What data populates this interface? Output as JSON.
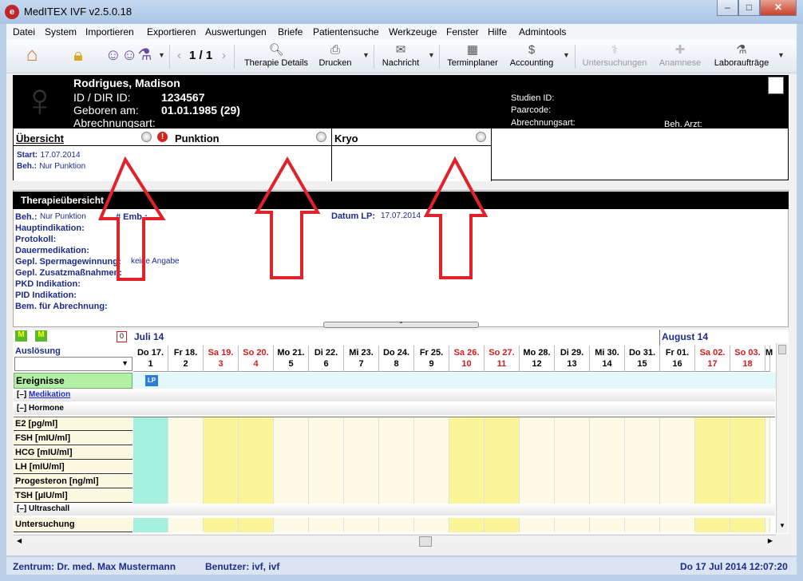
{
  "window": {
    "title": "MedITEX IVF v2.5.0.18",
    "app_icon": "e"
  },
  "menubar": [
    "Datei",
    "System",
    "Importieren",
    "Exportieren",
    "Auswertungen",
    "Briefe",
    "Patientensuche",
    "Werkzeuge",
    "Fenster",
    "Hilfe",
    "Admintools"
  ],
  "toolbar": {
    "page_indicator": "1 / 1",
    "therapie_details": "Therapie Details",
    "drucken": "Drucken",
    "nachricht": "Nachricht",
    "terminplaner": "Terminplaner",
    "accounting": "Accounting",
    "untersuchungen": "Untersuchungen",
    "anamnese": "Anamnese",
    "laborauftraege": "Laboraufträge"
  },
  "patient": {
    "name": "Rodrigues, Madison",
    "id_label": "ID / DIR ID:",
    "id_value": "1234567",
    "born_label": "Geboren am:",
    "born_value": "01.01.1985",
    "age": "(29)",
    "billing_label": "Abrechnungsart:",
    "studien_id_label": "Studien ID:",
    "paarcode_label": "Paarcode:",
    "abrechnungsart_label": "Abrechnungsart:",
    "beh_arzt_label": "Beh. Arzt:"
  },
  "tabs": [
    {
      "title": "Übersicht",
      "start_label": "Start:",
      "start_value": "17.07.2014",
      "beh_label": "Beh.:",
      "beh_value": "Nur Punktion"
    },
    {
      "title": "Punktion"
    },
    {
      "title": "Kryo"
    }
  ],
  "therapy": {
    "header": "Therapieübersicht",
    "beh_label": "Beh.:",
    "beh_value": "Nur Punktion",
    "emb_label": "# Emb.:",
    "datum_lp_label": "Datum LP:",
    "datum_lp_value": "17.07.2014",
    "fields": [
      "Hauptindikation:",
      "Protokoll:",
      "Dauermedikation:",
      "Gepl. Spermagewinnung:",
      "Gepl. Zusatzmaßnahmen:",
      "PKD Indikation:",
      "PID Indikation:",
      "Bem. für Abrechnung:"
    ],
    "sperm_value": "keine Angabe"
  },
  "calendar": {
    "month1": "Juli 14",
    "month2": "August 14",
    "ausloesung_label": "Auslösung",
    "calendar_icon_day": "0",
    "days": [
      {
        "d": "Do 17.",
        "n": "1"
      },
      {
        "d": "Fr 18.",
        "n": "2"
      },
      {
        "d": "Sa 19.",
        "n": "3"
      },
      {
        "d": "So 20.",
        "n": "4"
      },
      {
        "d": "Mo 21.",
        "n": "5"
      },
      {
        "d": "Di 22.",
        "n": "6"
      },
      {
        "d": "Mi 23.",
        "n": "7"
      },
      {
        "d": "Do 24.",
        "n": "8"
      },
      {
        "d": "Fr 25.",
        "n": "9"
      },
      {
        "d": "Sa 26.",
        "n": "10"
      },
      {
        "d": "So 27.",
        "n": "11"
      },
      {
        "d": "Mo 28.",
        "n": "12"
      },
      {
        "d": "Di 29.",
        "n": "13"
      },
      {
        "d": "Mi 30.",
        "n": "14"
      },
      {
        "d": "Do 31.",
        "n": "15"
      },
      {
        "d": "Fr 01.",
        "n": "16"
      },
      {
        "d": "Sa 02.",
        "n": "17"
      },
      {
        "d": "So 03.",
        "n": "18"
      },
      {
        "d": "M",
        "n": ""
      }
    ],
    "ereignisse_label": "Ereignisse",
    "lp_badge": "LP",
    "section_medikation": "Medikation",
    "section_hormone": "Hormone",
    "section_ultraschall": "Ultraschall",
    "hormone_rows": [
      "E2  [pg/ml]",
      "FSH  [mIU/ml]",
      "HCG  [mIU/ml]",
      "LH  [mIU/ml]",
      "Progesteron  [ng/ml]",
      "TSH  [µIU/ml]"
    ],
    "untersuchung_label": "Untersuchung",
    "collapse_symbol": "[–]"
  },
  "statusbar": {
    "zentrum": "Zentrum: Dr. med. Max Mustermann",
    "benutzer": "Benutzer: ivf, ivf",
    "datetime": "Do 17 Jul 2014 12:07:20"
  },
  "colors": {
    "weekend_col": "#fbf59a",
    "event_col": "#a5f0dc",
    "weekday_col": "#fdfbe6",
    "arrow": "#e0232b",
    "header_navy": "#1e2c8c"
  }
}
